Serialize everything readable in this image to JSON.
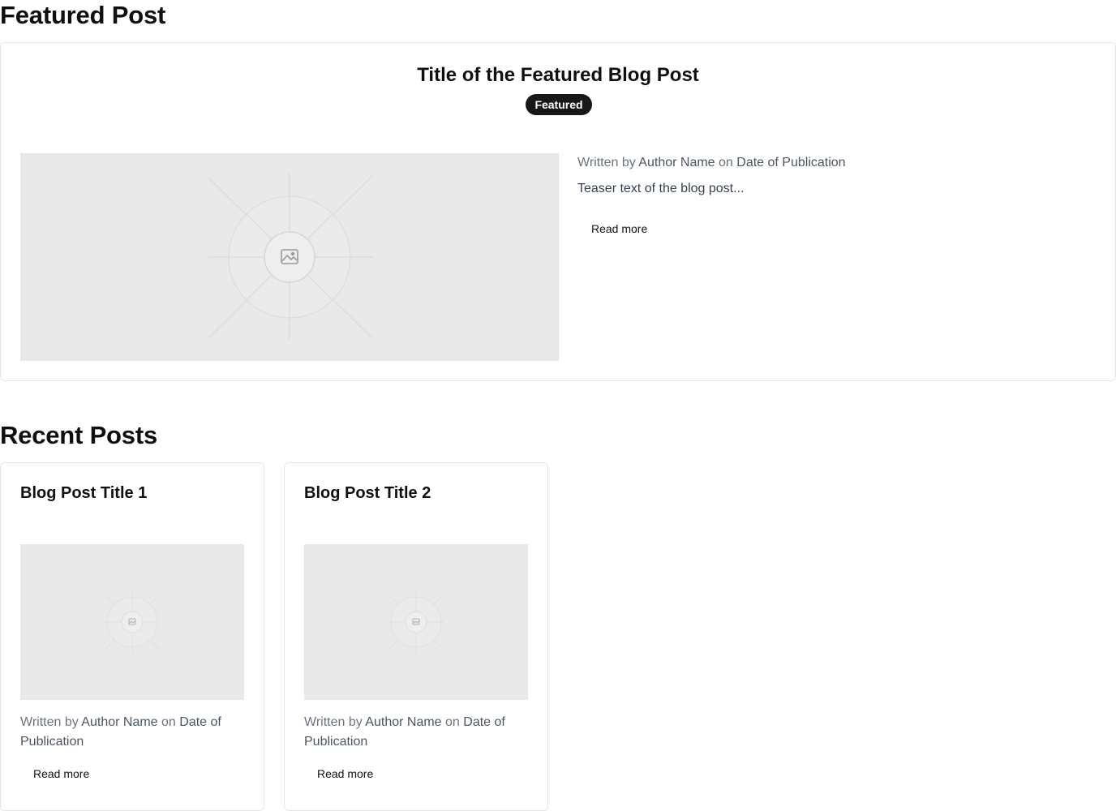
{
  "featured_section": {
    "heading": "Featured Post",
    "post": {
      "title": "Title of the Featured Blog Post",
      "badge": "Featured",
      "image_icon": "image-placeholder-icon",
      "meta": {
        "prefix": "Written by",
        "author": "Author Name",
        "joiner": "on",
        "date": "Date of Publication"
      },
      "teaser": "Teaser text of the blog post...",
      "read_more": "Read more"
    }
  },
  "recent_section": {
    "heading": "Recent Posts",
    "posts": [
      {
        "title": "Blog Post Title 1",
        "image_icon": "image-placeholder-icon",
        "meta": {
          "prefix": "Written by",
          "author": "Author Name",
          "joiner": "on",
          "date": "Date of Publication"
        },
        "read_more": "Read more"
      },
      {
        "title": "Blog Post Title 2",
        "image_icon": "image-placeholder-icon",
        "meta": {
          "prefix": "Written by",
          "author": "Author Name",
          "joiner": "on",
          "date": "Date of Publication"
        },
        "read_more": "Read more"
      }
    ]
  },
  "colors": {
    "badge_bg": "#18181b",
    "placeholder_bg": "#e9e9e9",
    "meta_text": "#6b7280",
    "card_border": "#e5e7eb"
  }
}
